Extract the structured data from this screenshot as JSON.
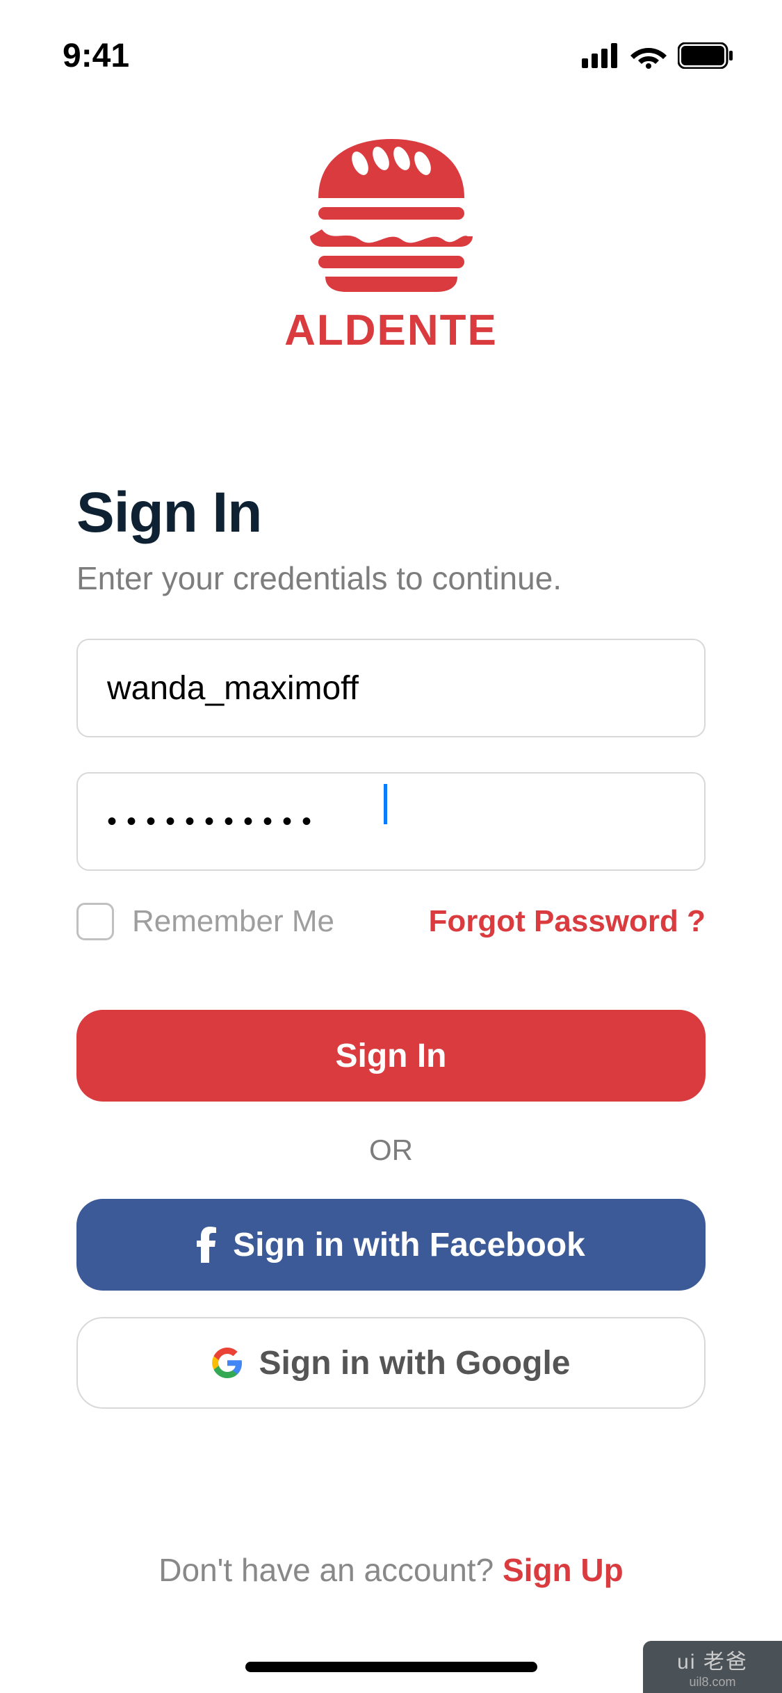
{
  "status": {
    "time": "9:41"
  },
  "logo": {
    "brand": "ALDENTE"
  },
  "form": {
    "heading": "Sign In",
    "subheading": "Enter your credentials to continue.",
    "username_value": "wanda_maximoff",
    "password_value": "•••••••••••",
    "remember_label": "Remember Me",
    "forgot_label": "Forgot Password ?",
    "signin_label": "Sign In",
    "divider": "OR",
    "facebook_label": "Sign in with Facebook",
    "google_label": "Sign in with Google"
  },
  "footer": {
    "text": "Don't have an account? ",
    "signup": "Sign Up"
  },
  "watermark": {
    "top": "ui 老爸",
    "bottom": "uil8.com"
  }
}
